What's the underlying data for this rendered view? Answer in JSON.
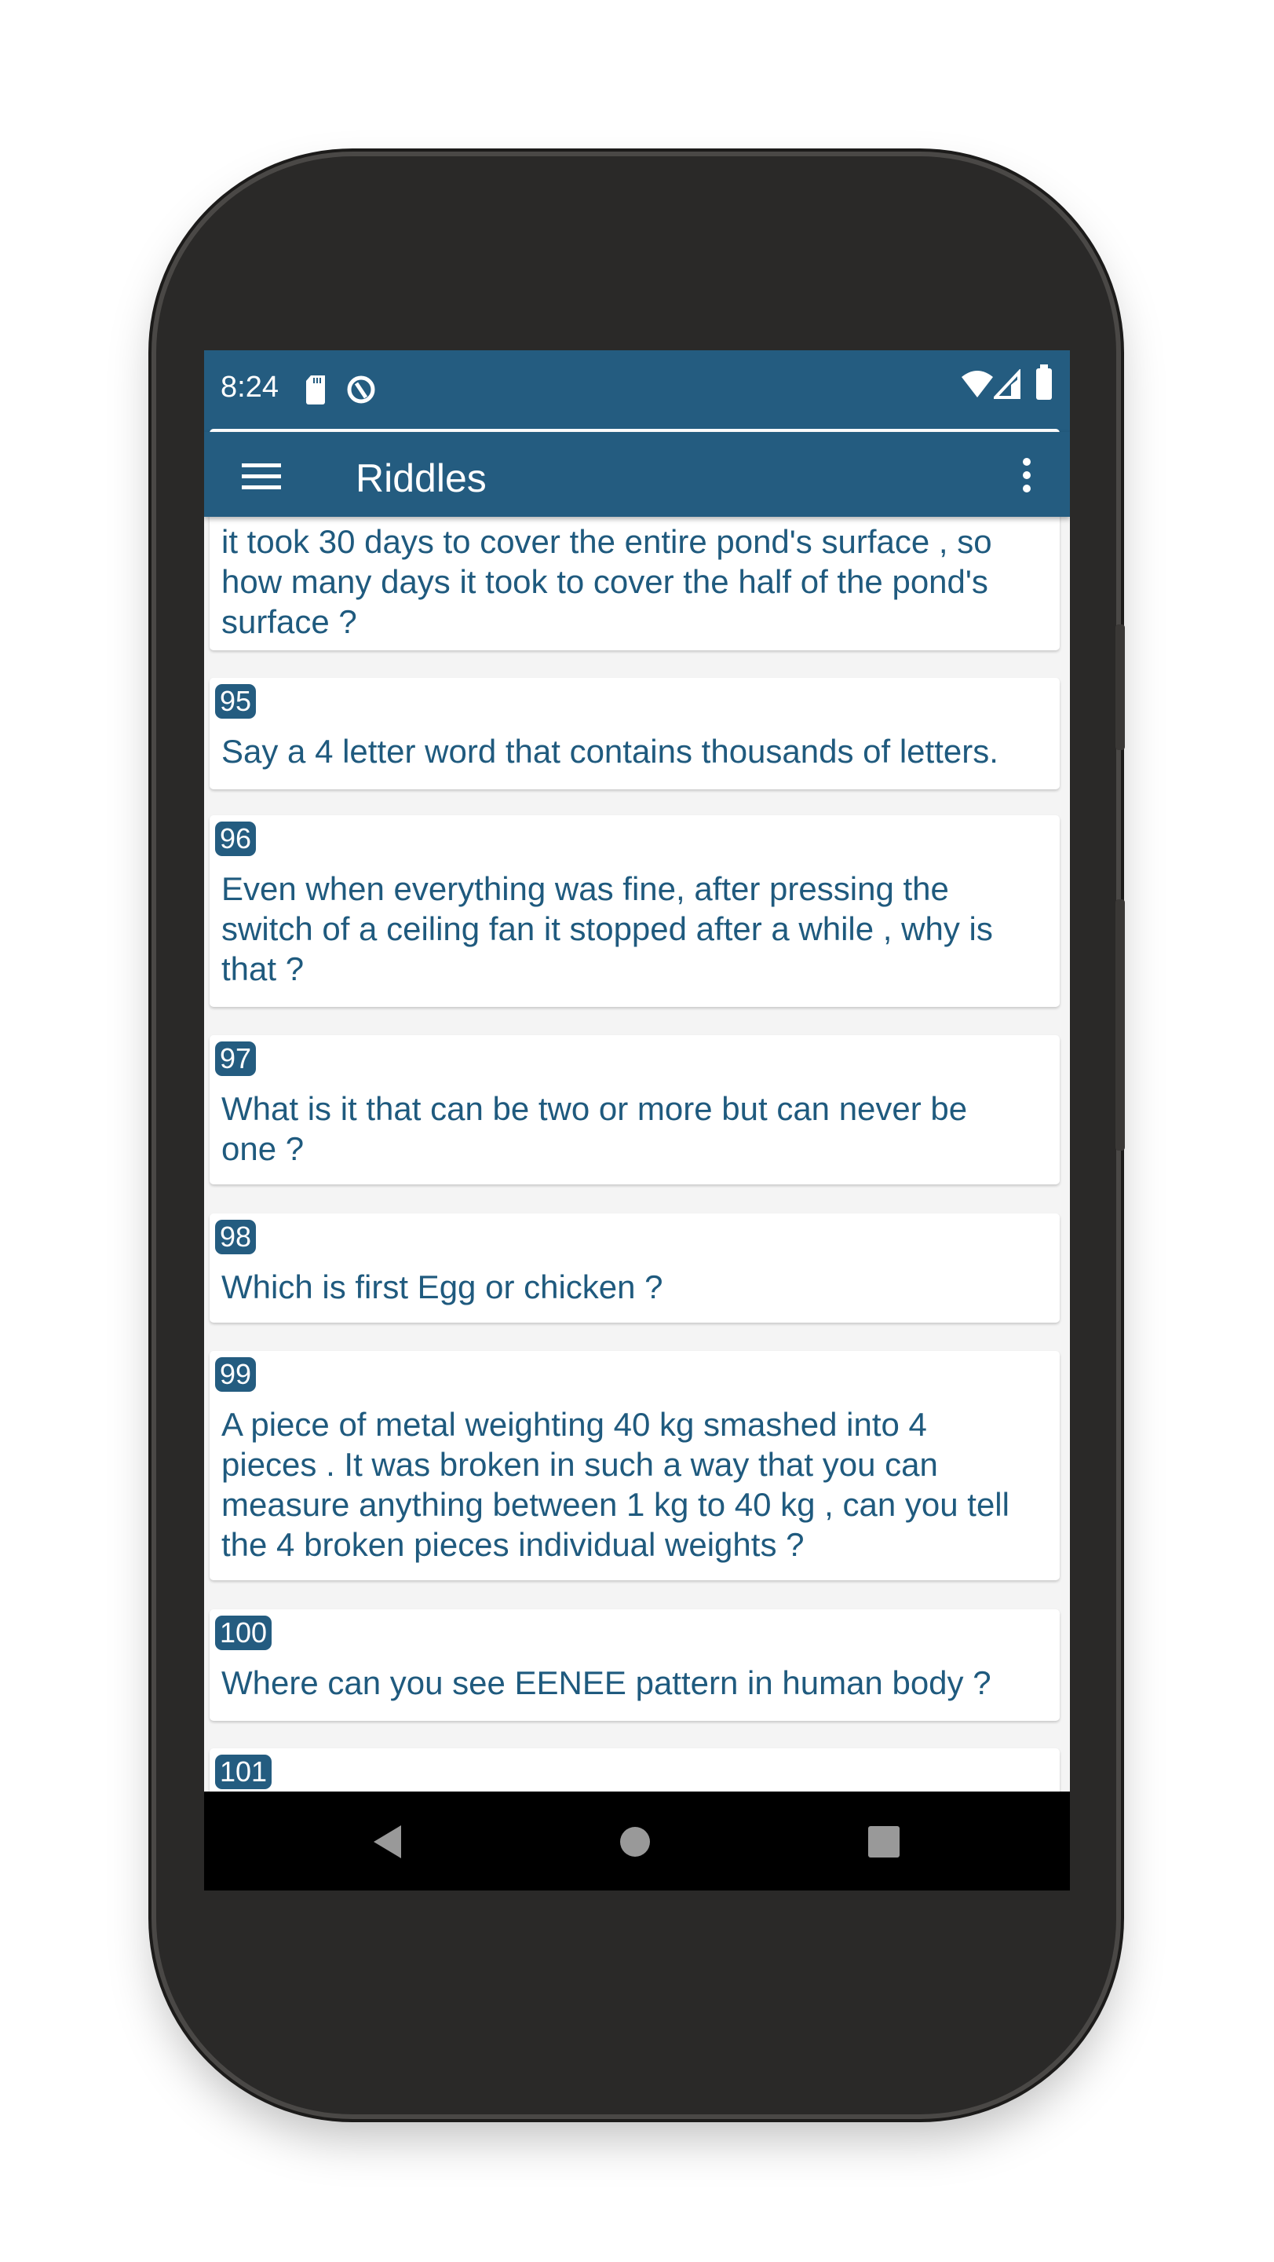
{
  "status_bar": {
    "time": "8:24",
    "icons": [
      "sd-card-icon",
      "data-saver-icon",
      "wifi-icon",
      "signal-icon",
      "battery-icon"
    ]
  },
  "app_bar": {
    "title": "Riddles",
    "menu_icon": "hamburger-icon",
    "overflow_icon": "more-vert-icon"
  },
  "colors": {
    "primary": "#245c80",
    "text": "#1f5a7e",
    "background": "#f4f4f4"
  },
  "riddles": [
    {
      "number": "",
      "text": "it took 30 days to cover the entire pond's surface , so how many days it took to cover the half of the pond's surface ?"
    },
    {
      "number": "95",
      "text": "Say a 4 letter word that contains thousands of letters."
    },
    {
      "number": "96",
      "text": "Even when everything was fine, after pressing the switch of a ceiling fan it stopped after a while , why is that ?"
    },
    {
      "number": "97",
      "text": "What is it that can be two or more but can never be one ?"
    },
    {
      "number": "98",
      "text": "Which is first Egg or chicken ?"
    },
    {
      "number": "99",
      "text": "A piece of metal weighting 40 kg smashed into 4 pieces . It was broken in such a way that you can measure anything between 1 kg to 40 kg , can you tell the 4 broken pieces individual weights ?"
    },
    {
      "number": "100",
      "text": "Where can you see EENEE pattern in human body ?"
    },
    {
      "number": "101",
      "text": ""
    }
  ],
  "nav_bar": [
    "back-icon",
    "home-icon",
    "recents-icon"
  ]
}
